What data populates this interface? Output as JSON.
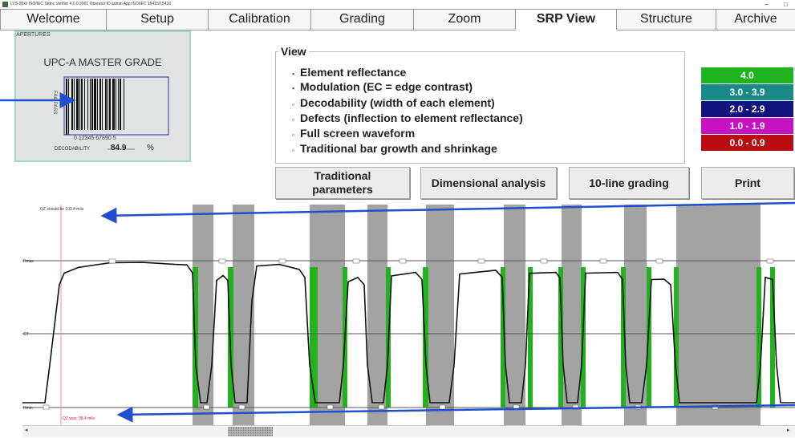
{
  "window": {
    "title": "LVS-95xx ISO/IEC Stdnc Verifier 4.0.0.3001   Operator:ID admin   App:ISO/IEC 15415/15416",
    "minimize_glyph": "–",
    "restore_glyph": "□"
  },
  "tabs": [
    "Welcome",
    "Setup",
    "Calibration",
    "Grading",
    "Zoom",
    "SRP View",
    "Structure",
    "Archive"
  ],
  "active_tab": "SRP View",
  "thumbnail": {
    "caption": "APERTURES",
    "title": "UPC-A MASTER GRADE",
    "side_label": "FAIL PASS",
    "barcode_digits": "0  12345  67890  5",
    "decodability_label": "DECODABILITY",
    "decodability_value": "84.9",
    "decodability_unit": "%"
  },
  "view_panel": {
    "legend": "View",
    "options": [
      {
        "label": "Element reflectance",
        "selected": true
      },
      {
        "label": "Modulation (EC = edge contrast)",
        "selected": true
      },
      {
        "label": "Decodability (width of each element)",
        "selected": false
      },
      {
        "label": "Defects (inflection to element reflectance)",
        "selected": false
      },
      {
        "label": "Full screen waveform",
        "selected": false
      },
      {
        "label": "Traditional bar growth and shrinkage",
        "selected": false
      }
    ]
  },
  "grade_legend": [
    {
      "label": "4.0",
      "color": "#22b320"
    },
    {
      "label": "3.0 - 3.9",
      "color": "#1a8a88"
    },
    {
      "label": "2.0 - 2.9",
      "color": "#13137e"
    },
    {
      "label": "1.0 - 1.9",
      "color": "#c513c2"
    },
    {
      "label": "0.0 - 0.9",
      "color": "#b80e12"
    }
  ],
  "buttons": {
    "traditional_line1": "Traditional",
    "traditional_line2": "parameters",
    "dimensional": "Dimensional analysis",
    "ten_line": "10-line grading",
    "print": "Print"
  },
  "waveform": {
    "quiet_zone_top": "QZ should be 103.4 mils",
    "quiet_zone_bottom": "QZ was: 98.4 mils",
    "levels": {
      "rmax": "Rmax",
      "gt": "GT",
      "rmin": "Rmin"
    }
  },
  "scrollbar": {
    "left_glyph": "◂",
    "right_glyph": "▸"
  }
}
